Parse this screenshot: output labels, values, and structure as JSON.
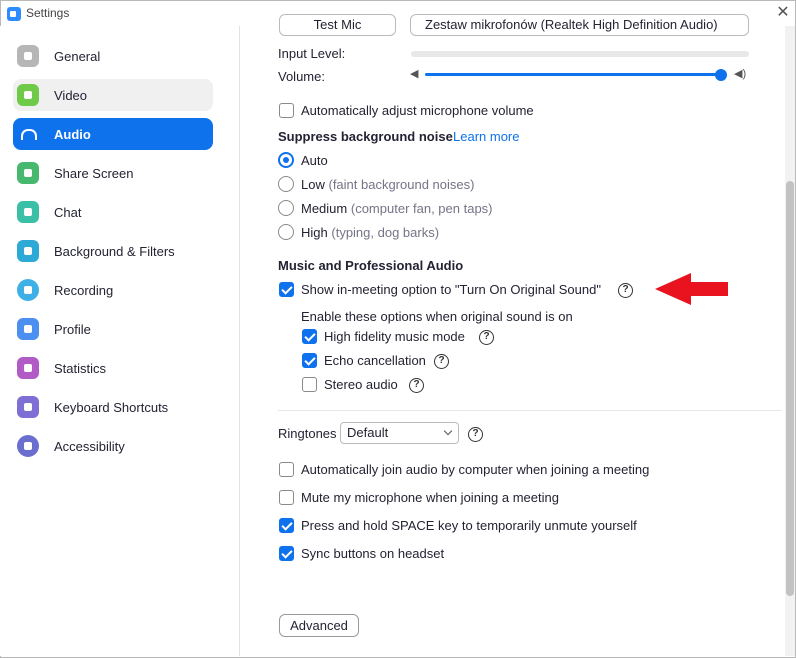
{
  "window": {
    "title": "Settings"
  },
  "colors": {
    "accent": "#0e72ed",
    "arrow": "#e8131e"
  },
  "sidebar": {
    "items": [
      {
        "label": "General",
        "icon": "gear-icon",
        "color": "#b6b6b6"
      },
      {
        "label": "Video",
        "icon": "video-camera-icon",
        "color": "#6fca49"
      },
      {
        "label": "Audio",
        "icon": "headphones-icon",
        "color": "#0e72ed"
      },
      {
        "label": "Share Screen",
        "icon": "share-screen-icon",
        "color": "#46b96e"
      },
      {
        "label": "Chat",
        "icon": "chat-bubble-icon",
        "color": "#3bbfa6"
      },
      {
        "label": "Background & Filters",
        "icon": "background-person-icon",
        "color": "#2da9d6"
      },
      {
        "label": "Recording",
        "icon": "record-icon",
        "color": "#3eb0e6"
      },
      {
        "label": "Profile",
        "icon": "profile-person-icon",
        "color": "#4c8ff0"
      },
      {
        "label": "Statistics",
        "icon": "bar-chart-icon",
        "color": "#b05bc6"
      },
      {
        "label": "Keyboard Shortcuts",
        "icon": "keyboard-icon",
        "color": "#7d6fd3"
      },
      {
        "label": "Accessibility",
        "icon": "accessibility-icon",
        "color": "#6a6fcf"
      }
    ]
  },
  "mic": {
    "test_label": "Test Mic",
    "device": "Zestaw mikrofonów (Realtek High Definition Audio)",
    "input_level_label": "Input Level:",
    "volume_label": "Volume:",
    "volume_level": 1.0
  },
  "auto_adjust": {
    "label": "Automatically adjust microphone volume",
    "checked": false
  },
  "suppress": {
    "heading": "Suppress background noise",
    "learn_more": "Learn more",
    "options": [
      {
        "label": "Auto",
        "hint": "",
        "checked": true
      },
      {
        "label": "Low",
        "hint": "(faint background noises)",
        "checked": false
      },
      {
        "label": "Medium",
        "hint": "(computer fan, pen taps)",
        "checked": false
      },
      {
        "label": "High",
        "hint": "(typing, dog barks)",
        "checked": false
      }
    ]
  },
  "music": {
    "heading": "Music and Professional Audio",
    "original_sound": {
      "label": "Show in-meeting option to \"Turn On Original Sound\"",
      "checked": true
    },
    "sub_heading": "Enable these options when original sound is on",
    "options": [
      {
        "label": "High fidelity music mode",
        "checked": true
      },
      {
        "label": "Echo cancellation",
        "checked": true
      },
      {
        "label": "Stereo audio",
        "checked": false
      }
    ]
  },
  "ringtones": {
    "label": "Ringtones",
    "value": "Default"
  },
  "general_options": [
    {
      "label": "Automatically join audio by computer when joining a meeting",
      "checked": false
    },
    {
      "label": "Mute my microphone when joining a meeting",
      "checked": false
    },
    {
      "label": "Press and hold SPACE key to temporarily unmute yourself",
      "checked": true
    },
    {
      "label": "Sync buttons on headset",
      "checked": true
    }
  ],
  "advanced_label": "Advanced",
  "help_glyph": "?"
}
